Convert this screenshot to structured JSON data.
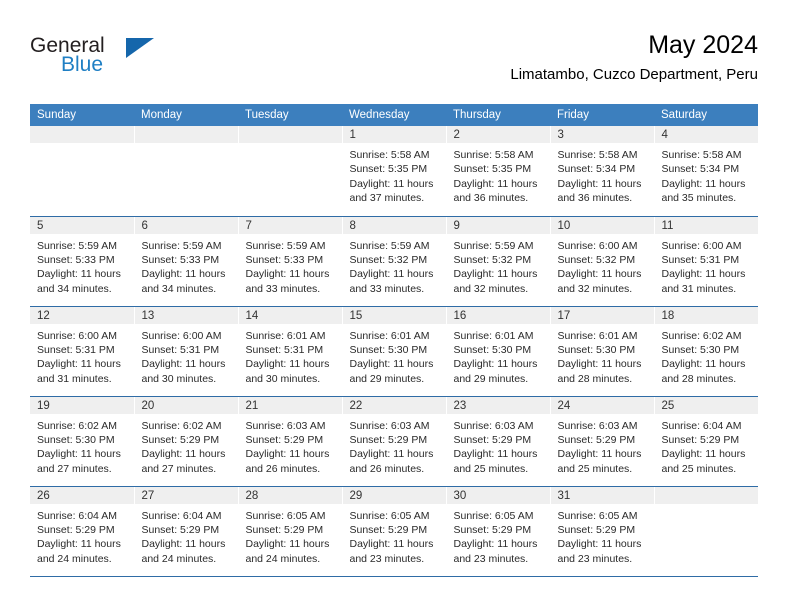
{
  "brand": {
    "name_top": "General",
    "name_bottom": "Blue",
    "triangle_icon": "triangle-icon",
    "colors": {
      "text": "#231f20",
      "blue": "#1f7fc4",
      "triangle": "#1566ab"
    }
  },
  "header": {
    "title": "May 2024",
    "subtitle": "Limatambo, Cuzco Department, Peru"
  },
  "calendar": {
    "accent_color": "#3c7fbe",
    "daynum_bg": "#efefef",
    "weekday_headers": [
      "Sunday",
      "Monday",
      "Tuesday",
      "Wednesday",
      "Thursday",
      "Friday",
      "Saturday"
    ],
    "weeks": [
      [
        {
          "day": "",
          "lines": []
        },
        {
          "day": "",
          "lines": []
        },
        {
          "day": "",
          "lines": []
        },
        {
          "day": "1",
          "lines": [
            "Sunrise: 5:58 AM",
            "Sunset: 5:35 PM",
            "Daylight: 11 hours",
            "and 37 minutes."
          ]
        },
        {
          "day": "2",
          "lines": [
            "Sunrise: 5:58 AM",
            "Sunset: 5:35 PM",
            "Daylight: 11 hours",
            "and 36 minutes."
          ]
        },
        {
          "day": "3",
          "lines": [
            "Sunrise: 5:58 AM",
            "Sunset: 5:34 PM",
            "Daylight: 11 hours",
            "and 36 minutes."
          ]
        },
        {
          "day": "4",
          "lines": [
            "Sunrise: 5:58 AM",
            "Sunset: 5:34 PM",
            "Daylight: 11 hours",
            "and 35 minutes."
          ]
        }
      ],
      [
        {
          "day": "5",
          "lines": [
            "Sunrise: 5:59 AM",
            "Sunset: 5:33 PM",
            "Daylight: 11 hours",
            "and 34 minutes."
          ]
        },
        {
          "day": "6",
          "lines": [
            "Sunrise: 5:59 AM",
            "Sunset: 5:33 PM",
            "Daylight: 11 hours",
            "and 34 minutes."
          ]
        },
        {
          "day": "7",
          "lines": [
            "Sunrise: 5:59 AM",
            "Sunset: 5:33 PM",
            "Daylight: 11 hours",
            "and 33 minutes."
          ]
        },
        {
          "day": "8",
          "lines": [
            "Sunrise: 5:59 AM",
            "Sunset: 5:32 PM",
            "Daylight: 11 hours",
            "and 33 minutes."
          ]
        },
        {
          "day": "9",
          "lines": [
            "Sunrise: 5:59 AM",
            "Sunset: 5:32 PM",
            "Daylight: 11 hours",
            "and 32 minutes."
          ]
        },
        {
          "day": "10",
          "lines": [
            "Sunrise: 6:00 AM",
            "Sunset: 5:32 PM",
            "Daylight: 11 hours",
            "and 32 minutes."
          ]
        },
        {
          "day": "11",
          "lines": [
            "Sunrise: 6:00 AM",
            "Sunset: 5:31 PM",
            "Daylight: 11 hours",
            "and 31 minutes."
          ]
        }
      ],
      [
        {
          "day": "12",
          "lines": [
            "Sunrise: 6:00 AM",
            "Sunset: 5:31 PM",
            "Daylight: 11 hours",
            "and 31 minutes."
          ]
        },
        {
          "day": "13",
          "lines": [
            "Sunrise: 6:00 AM",
            "Sunset: 5:31 PM",
            "Daylight: 11 hours",
            "and 30 minutes."
          ]
        },
        {
          "day": "14",
          "lines": [
            "Sunrise: 6:01 AM",
            "Sunset: 5:31 PM",
            "Daylight: 11 hours",
            "and 30 minutes."
          ]
        },
        {
          "day": "15",
          "lines": [
            "Sunrise: 6:01 AM",
            "Sunset: 5:30 PM",
            "Daylight: 11 hours",
            "and 29 minutes."
          ]
        },
        {
          "day": "16",
          "lines": [
            "Sunrise: 6:01 AM",
            "Sunset: 5:30 PM",
            "Daylight: 11 hours",
            "and 29 minutes."
          ]
        },
        {
          "day": "17",
          "lines": [
            "Sunrise: 6:01 AM",
            "Sunset: 5:30 PM",
            "Daylight: 11 hours",
            "and 28 minutes."
          ]
        },
        {
          "day": "18",
          "lines": [
            "Sunrise: 6:02 AM",
            "Sunset: 5:30 PM",
            "Daylight: 11 hours",
            "and 28 minutes."
          ]
        }
      ],
      [
        {
          "day": "19",
          "lines": [
            "Sunrise: 6:02 AM",
            "Sunset: 5:30 PM",
            "Daylight: 11 hours",
            "and 27 minutes."
          ]
        },
        {
          "day": "20",
          "lines": [
            "Sunrise: 6:02 AM",
            "Sunset: 5:29 PM",
            "Daylight: 11 hours",
            "and 27 minutes."
          ]
        },
        {
          "day": "21",
          "lines": [
            "Sunrise: 6:03 AM",
            "Sunset: 5:29 PM",
            "Daylight: 11 hours",
            "and 26 minutes."
          ]
        },
        {
          "day": "22",
          "lines": [
            "Sunrise: 6:03 AM",
            "Sunset: 5:29 PM",
            "Daylight: 11 hours",
            "and 26 minutes."
          ]
        },
        {
          "day": "23",
          "lines": [
            "Sunrise: 6:03 AM",
            "Sunset: 5:29 PM",
            "Daylight: 11 hours",
            "and 25 minutes."
          ]
        },
        {
          "day": "24",
          "lines": [
            "Sunrise: 6:03 AM",
            "Sunset: 5:29 PM",
            "Daylight: 11 hours",
            "and 25 minutes."
          ]
        },
        {
          "day": "25",
          "lines": [
            "Sunrise: 6:04 AM",
            "Sunset: 5:29 PM",
            "Daylight: 11 hours",
            "and 25 minutes."
          ]
        }
      ],
      [
        {
          "day": "26",
          "lines": [
            "Sunrise: 6:04 AM",
            "Sunset: 5:29 PM",
            "Daylight: 11 hours",
            "and 24 minutes."
          ]
        },
        {
          "day": "27",
          "lines": [
            "Sunrise: 6:04 AM",
            "Sunset: 5:29 PM",
            "Daylight: 11 hours",
            "and 24 minutes."
          ]
        },
        {
          "day": "28",
          "lines": [
            "Sunrise: 6:05 AM",
            "Sunset: 5:29 PM",
            "Daylight: 11 hours",
            "and 24 minutes."
          ]
        },
        {
          "day": "29",
          "lines": [
            "Sunrise: 6:05 AM",
            "Sunset: 5:29 PM",
            "Daylight: 11 hours",
            "and 23 minutes."
          ]
        },
        {
          "day": "30",
          "lines": [
            "Sunrise: 6:05 AM",
            "Sunset: 5:29 PM",
            "Daylight: 11 hours",
            "and 23 minutes."
          ]
        },
        {
          "day": "31",
          "lines": [
            "Sunrise: 6:05 AM",
            "Sunset: 5:29 PM",
            "Daylight: 11 hours",
            "and 23 minutes."
          ]
        },
        {
          "day": "",
          "lines": []
        }
      ]
    ]
  }
}
